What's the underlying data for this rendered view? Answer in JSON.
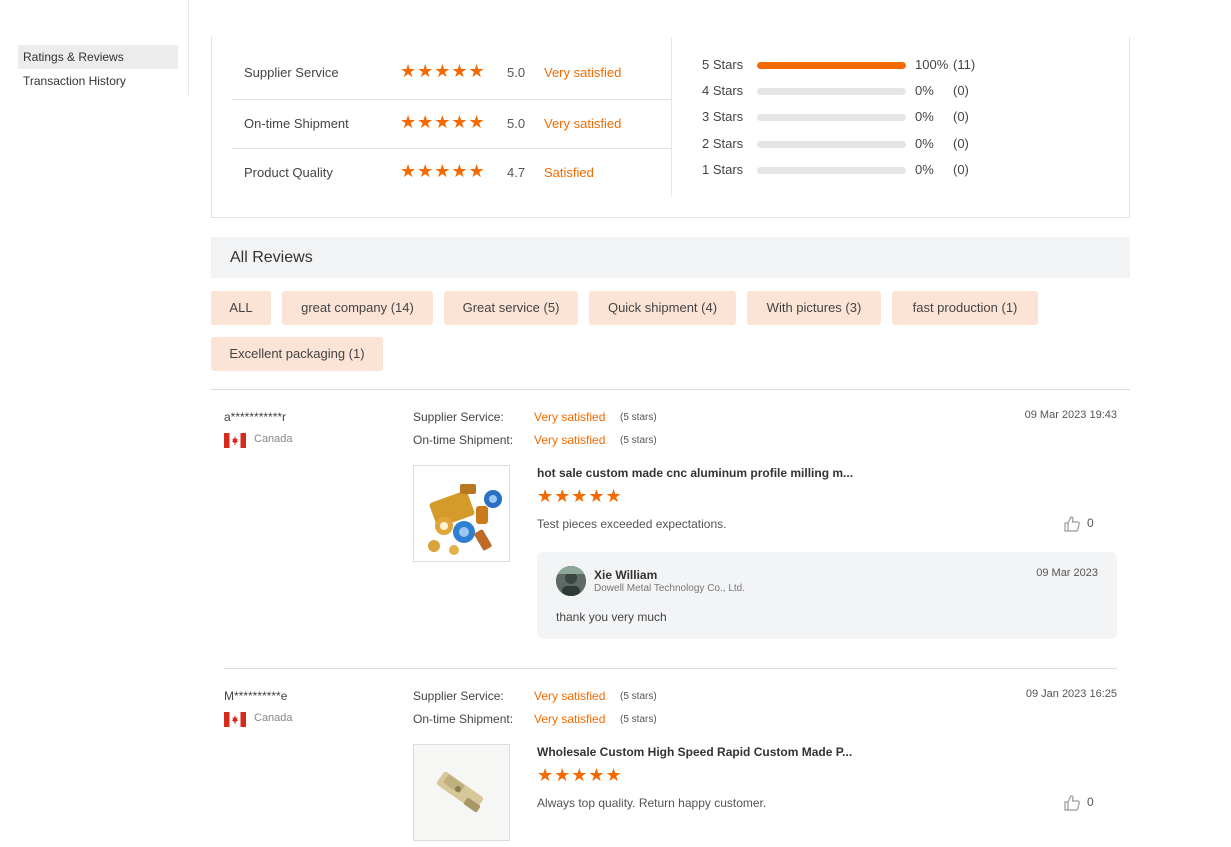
{
  "sidebar": {
    "items": [
      {
        "label": "Ratings & Reviews"
      },
      {
        "label": "Transaction History"
      }
    ]
  },
  "ratings": {
    "rows": [
      {
        "label": "Supplier Service",
        "stars": "★★★★★",
        "score": "5.0",
        "satisfaction": "Very satisfied"
      },
      {
        "label": "On-time Shipment",
        "stars": "★★★★★",
        "score": "5.0",
        "satisfaction": "Very satisfied"
      },
      {
        "label": "Product Quality",
        "stars": "★★★★★",
        "score": "4.7",
        "satisfaction": "Satisfied"
      }
    ],
    "distribution": [
      {
        "label": "5 Stars",
        "fraction": 1.0,
        "percent": "100%",
        "count": "(11)"
      },
      {
        "label": "4 Stars",
        "fraction": 0,
        "percent": "0%",
        "count": "(0)"
      },
      {
        "label": "3 Stars",
        "fraction": 0,
        "percent": "0%",
        "count": "(0)"
      },
      {
        "label": "2 Stars",
        "fraction": 0,
        "percent": "0%",
        "count": "(0)"
      },
      {
        "label": "1 Stars",
        "fraction": 0,
        "percent": "0%",
        "count": "(0)"
      }
    ]
  },
  "all_reviews": {
    "title": "All Reviews",
    "tags": [
      "ALL",
      "great company (14)",
      "Great service (5)",
      "Quick shipment (4)",
      "With pictures (3)",
      "fast production (1)",
      "Excellent packaging (1)"
    ]
  },
  "reviews": [
    {
      "user": "a***********r",
      "country": "Canada",
      "supplier_label": "Supplier Service:",
      "supplier_value": "Very satisfied",
      "supplier_stars": "(5 stars)",
      "shipment_label": "On-time Shipment:",
      "shipment_value": "Very satisfied",
      "shipment_stars": "(5 stars)",
      "date": "09 Mar 2023 19:43",
      "product_title": "hot sale custom made cnc aluminum profile milling m...",
      "product_stars": "★★★★★",
      "comment": "Test pieces exceeded expectations.",
      "likes": "0",
      "reply": {
        "name": "Xie William",
        "company": "Dowell Metal Technology Co., Ltd.",
        "date": "09 Mar 2023",
        "text": "thank you very much"
      }
    },
    {
      "user": "M**********e",
      "country": "Canada",
      "supplier_label": "Supplier Service:",
      "supplier_value": "Very satisfied",
      "supplier_stars": "(5 stars)",
      "shipment_label": "On-time Shipment:",
      "shipment_value": "Very satisfied",
      "shipment_stars": "(5 stars)",
      "date": "09 Jan 2023 16:25",
      "product_title": "Wholesale Custom High Speed Rapid Custom Made P...",
      "product_stars": "★★★★★",
      "comment": "Always top quality. Return happy customer.",
      "likes": "0"
    }
  ],
  "colors": {
    "accent": "#f56a00",
    "tag_bg": "#fbe3d5",
    "header_bg": "#f2f3f5"
  }
}
